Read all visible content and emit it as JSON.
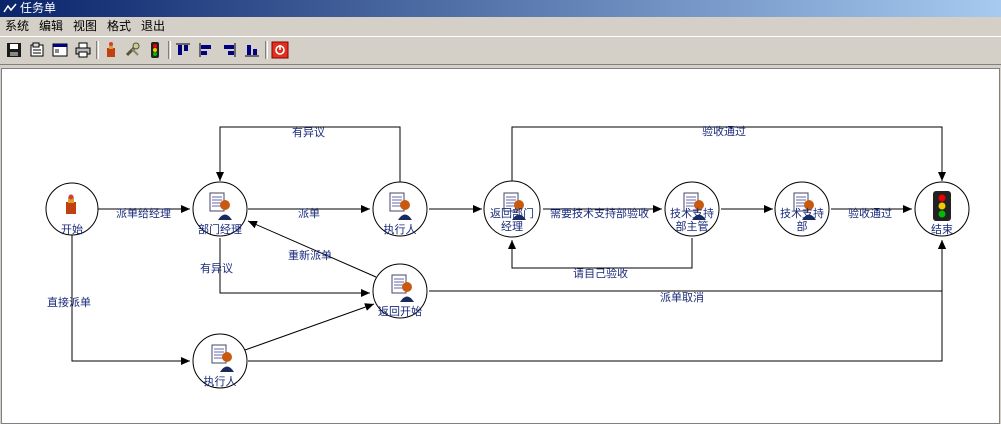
{
  "window": {
    "title": "任务单"
  },
  "menu": {
    "items": [
      "系统",
      "编辑",
      "视图",
      "格式",
      "退出"
    ]
  },
  "toolbar": {
    "buttons": [
      "save-icon",
      "open-icon",
      "window-icon",
      "print-icon",
      "start-node-icon",
      "tools-icon",
      "traffic-light-icon",
      "align-top-icon",
      "align-left-icon",
      "align-right-icon",
      "align-bottom-icon",
      "exit-icon"
    ]
  },
  "nodes": {
    "start": "开始",
    "dept_mgr": "部门经理",
    "executor1": "执行人",
    "return_dept_line1": "返回部门",
    "return_dept_line2": "经理",
    "tech_dept_mgr_line1": "技术支持",
    "tech_dept_mgr_line2": "部主管",
    "tech_dept_line1": "技术支持",
    "tech_dept_line2": "部",
    "end": "结束",
    "return_start": "返回开始",
    "executor2": "执行人"
  },
  "edges": {
    "assign_to_mgr": "派单给经理",
    "dispatch": "派单",
    "objection_top": "有异议",
    "acceptance_pass_top": "验收通过",
    "need_tech_accept": "需要技术支持部验收",
    "self_accept": "请自己验收",
    "acceptance_pass_right": "验收通过",
    "redispatch": "重新派单",
    "objection_left": "有异议",
    "direct_dispatch": "直接派单",
    "cancel": "派单取消"
  }
}
